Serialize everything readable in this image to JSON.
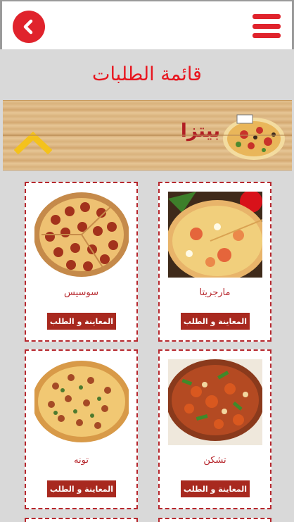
{
  "header": {
    "back_icon": "chevron-left-icon",
    "menu_icon": "hamburger-menu-icon",
    "accent_color": "#e0232c"
  },
  "page": {
    "title": "قائمة الطلبات"
  },
  "category": {
    "label": "بيتزا",
    "toggle_icon": "chevron-up-icon"
  },
  "products": [
    {
      "name": "مارجريتا",
      "button_label": "المعاينة و الطلب",
      "image": "margherita-pizza"
    },
    {
      "name": "سوسيس",
      "button_label": "المعاينة و الطلب",
      "image": "sausage-pizza"
    },
    {
      "name": "تشكن",
      "button_label": "المعاينة و الطلب",
      "image": "chicken-pizza"
    },
    {
      "name": "تونه",
      "button_label": "المعاينة و الطلب",
      "image": "tuna-pizza"
    }
  ]
}
